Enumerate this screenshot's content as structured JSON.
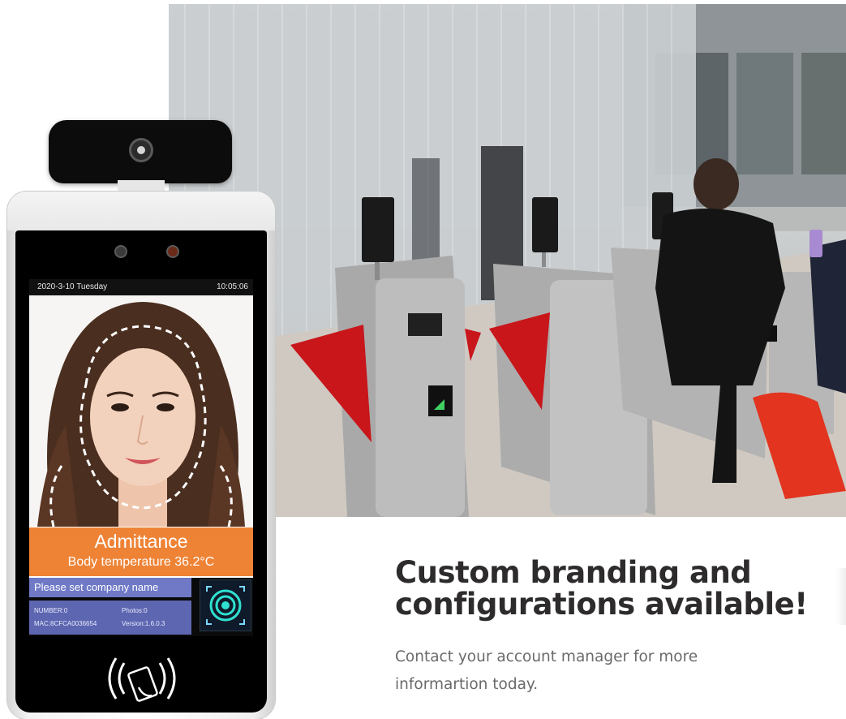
{
  "device": {
    "status_date": "2020-3-10 Tuesday",
    "status_time": "10:05:06",
    "admit_title": "Admittance",
    "admit_temp": "Body temperature 36.2°C",
    "company_name": "Please set company name",
    "meta_number": "NUMBER:0",
    "meta_photos": "Photos:0",
    "meta_mac": "MAC:8CFCA0036654",
    "meta_version": "Version:1.6.0.3"
  },
  "headline": {
    "line1": "Custom branding and",
    "line2": "configurations available!"
  },
  "subtext": {
    "line1": "Contact your account manager for more",
    "line2": "informartion today."
  },
  "colors": {
    "admit_orange": "#ee8336",
    "company_bar": "#6f79c6",
    "headline_text": "#2d2b2c",
    "subtext": "#6a6a6a",
    "turnstile_red": "#c8161b"
  },
  "icons": [
    "camera-icon",
    "face-scan-icon",
    "nfc-card-icon",
    "contactless-reader-icon",
    "entry-arrow-icon"
  ]
}
